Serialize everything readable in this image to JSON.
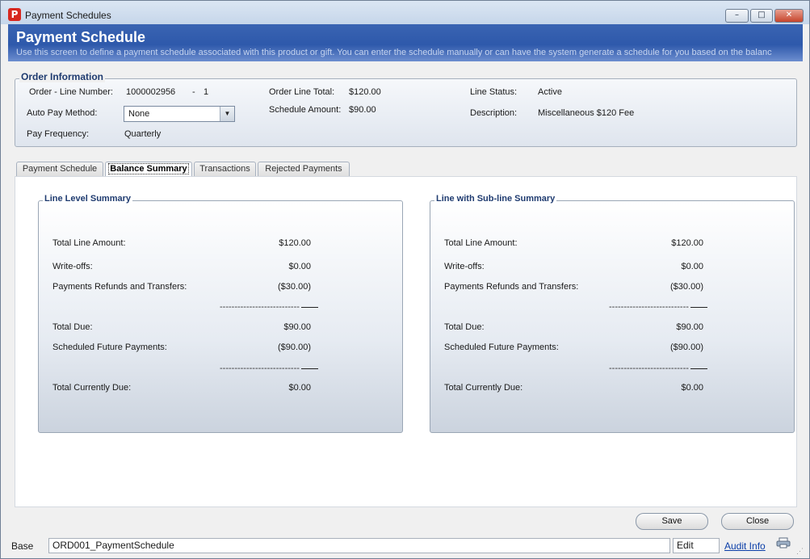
{
  "window": {
    "title": "Payment Schedules",
    "icon": "app-logo-icon",
    "min_glyph": "–",
    "max_glyph": "□",
    "close_glyph": "✕"
  },
  "banner": {
    "title": "Payment Schedule",
    "description": "Use this screen to define a payment schedule associated with this product or gift. You can enter the schedule manually or can have the system generate a schedule for you based on the balanc"
  },
  "order_info": {
    "title": "Order Information",
    "order_line_label": "Order - Line Number:",
    "order_number": "1000002956",
    "dash": "-",
    "line_number": "1",
    "auto_pay_label": "Auto Pay Method:",
    "auto_pay_value": "None",
    "pay_frequency_label": "Pay Frequency:",
    "pay_frequency_value": "Quarterly",
    "order_line_total_label": "Order Line Total:",
    "order_line_total_value": "$120.00",
    "schedule_amount_label": "Schedule Amount:",
    "schedule_amount_value": "$90.00",
    "line_status_label": "Line Status:",
    "line_status_value": "Active",
    "description_label": "Description:",
    "description_value": "Miscellaneous $120 Fee"
  },
  "tabs": [
    {
      "label": "Payment Schedule",
      "active": false
    },
    {
      "label": "Balance Summary",
      "active": true
    },
    {
      "label": "Transactions",
      "active": false
    },
    {
      "label": "Rejected Payments",
      "active": false
    }
  ],
  "line_level": {
    "title": "Line Level Summary",
    "rows": [
      {
        "label": "Total Line Amount:",
        "value": "$120.00"
      },
      {
        "label": "Write-offs:",
        "value": "$0.00"
      },
      {
        "label": "Payments Refunds and Transfers:",
        "value": "($30.00)"
      },
      {
        "label": "Total Due:",
        "value": "$90.00"
      },
      {
        "label": "Scheduled Future Payments:",
        "value": "($90.00)"
      },
      {
        "label": "Total Currently Due:",
        "value": "$0.00"
      }
    ],
    "separator": "---------------------------"
  },
  "sub_line": {
    "title": "Line with Sub-line Summary",
    "rows": [
      {
        "label": "Total Line Amount:",
        "value": "$120.00"
      },
      {
        "label": "Write-offs:",
        "value": "$0.00"
      },
      {
        "label": "Payments Refunds and Transfers:",
        "value": "($30.00)"
      },
      {
        "label": "Total Due:",
        "value": "$90.00"
      },
      {
        "label": "Scheduled Future Payments:",
        "value": "($90.00)"
      },
      {
        "label": "Total Currently Due:",
        "value": "$0.00"
      }
    ],
    "separator": "---------------------------"
  },
  "actions": {
    "save_label": "Save",
    "close_label": "Close"
  },
  "statusbar": {
    "context": "Base",
    "screen_id": "ORD001_PaymentSchedule",
    "mode": "Edit",
    "audit_link": "Audit Info",
    "printer_icon": "printer-icon"
  }
}
